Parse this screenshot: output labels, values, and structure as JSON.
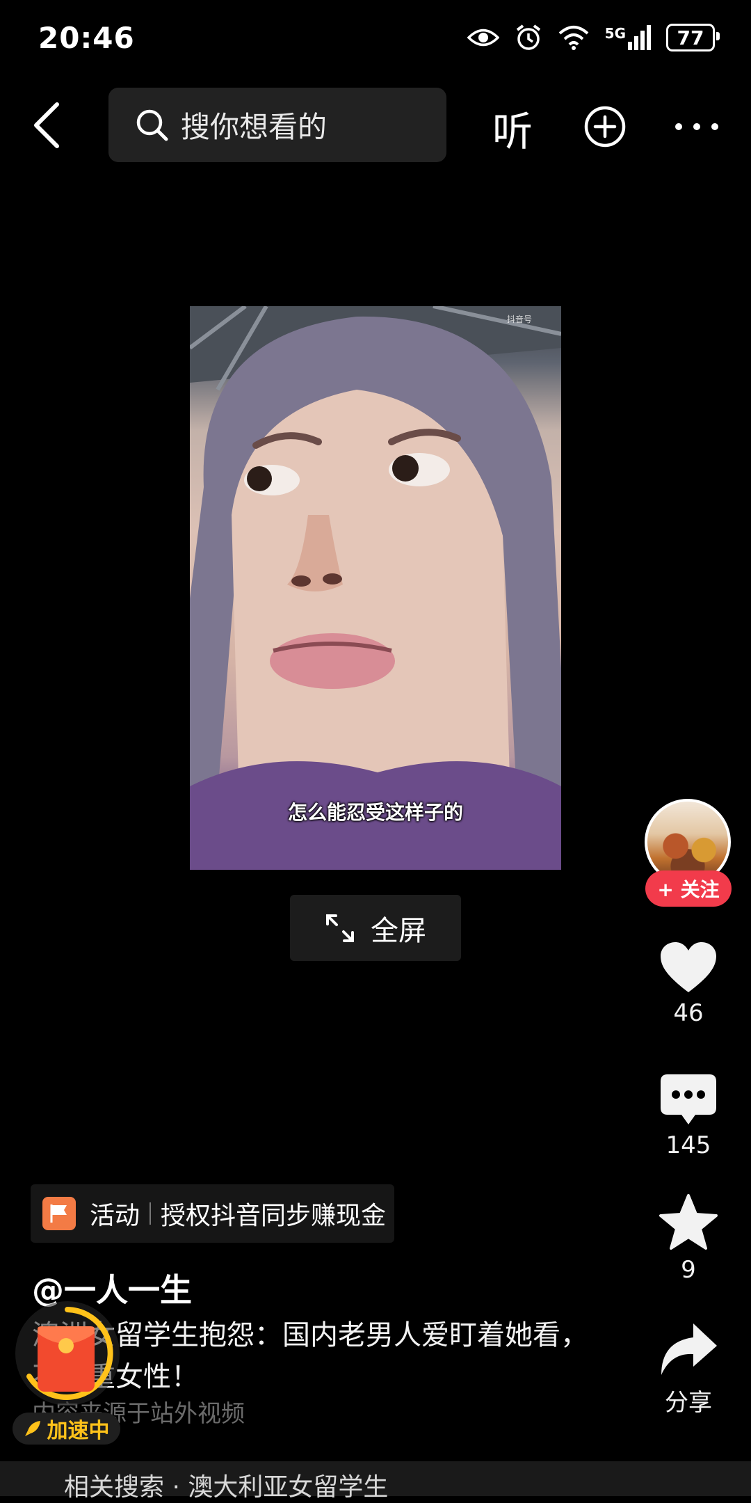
{
  "status_bar": {
    "time": "20:46",
    "network": "5G",
    "battery": "77"
  },
  "top_bar": {
    "search_placeholder": "搜你想看的",
    "listen_label": "听"
  },
  "video": {
    "subtitle": "怎么能忍受这样子的",
    "watermark": "抖音号"
  },
  "fullscreen": {
    "label": "全屏"
  },
  "right_rail": {
    "follow_label": "+ 关注",
    "like_count": "46",
    "comment_count": "145",
    "favorite_count": "9",
    "share_label": "分享"
  },
  "info": {
    "activity_label": "活动",
    "activity_text": "授权抖音同步赚现金",
    "author": "@一人一生",
    "description": "澳洲女留学生抱怨：国内老男人爱盯着她看，不尊重女性！",
    "source": "内容来源于站外视频",
    "speed_badge": "加速中"
  },
  "related_search": {
    "text": "相关搜索 · 澳大利亚女留学生"
  },
  "colors": {
    "accent": "#f23b4b",
    "flag": "#f37b45",
    "badge": "#ffc21a"
  }
}
